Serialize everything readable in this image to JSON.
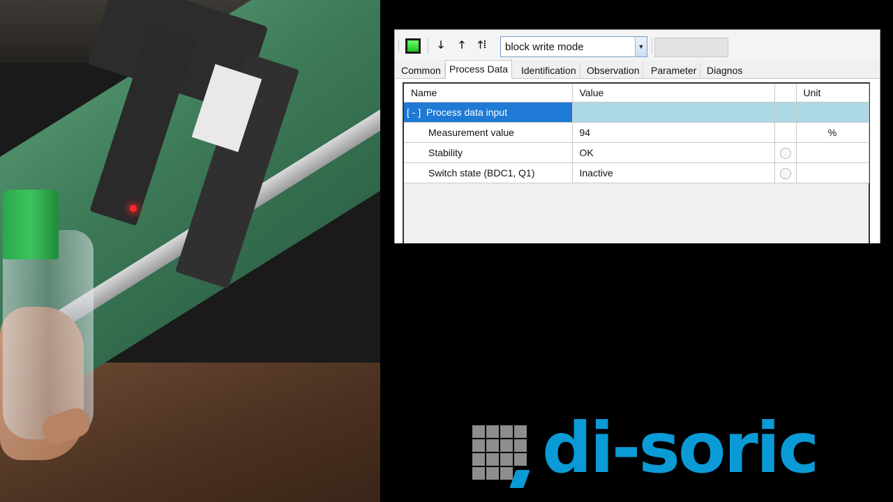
{
  "toolbar": {
    "mode_combo_value": "block write mode",
    "icons": [
      "status-indicator-icon",
      "arrow-down-icon",
      "arrow-up-icon",
      "arrow-up-all-icon",
      "dropdown-arrow-icon"
    ]
  },
  "tabs": [
    {
      "label": "Common",
      "active": false
    },
    {
      "label": "Process Data",
      "active": true
    },
    {
      "label": "Identification",
      "active": false
    },
    {
      "label": "Observation",
      "active": false
    },
    {
      "label": "Parameter",
      "active": false
    },
    {
      "label": "Diagnos",
      "active": false
    }
  ],
  "table": {
    "headers": {
      "name": "Name",
      "value": "Value",
      "unit": "Unit"
    },
    "group": {
      "toggle": "[ - ]",
      "label": "Process data input"
    },
    "rows": [
      {
        "name": "Measurement value",
        "value": "94",
        "unit": "%"
      },
      {
        "name": "Stability",
        "value": "OK",
        "unit": ""
      },
      {
        "name": "Switch state  (BDC1, Q1)",
        "value": "Inactive",
        "unit": ""
      }
    ]
  },
  "logo": {
    "text": "di-soric",
    "colors": {
      "text": "#0a9ad6",
      "mark": "#8d8d8d"
    }
  },
  "colors": {
    "selection": "#1e7ad4",
    "group_row": "#add8e6"
  }
}
